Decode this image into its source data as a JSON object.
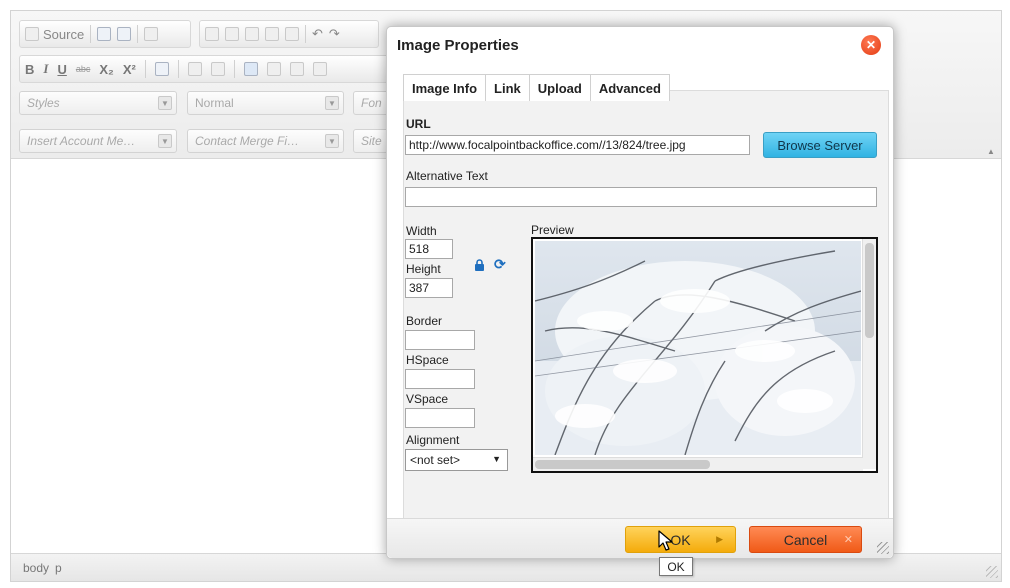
{
  "editor": {
    "toolbar": {
      "source_label": "Source",
      "bold_label": "B",
      "italic_label": "I",
      "underline_label": "U",
      "strike_label": "abc",
      "subscript_label": "X₂",
      "superscript_label": "X²",
      "styles_placeholder": "Styles",
      "format_value": "Normal",
      "font_placeholder": "Fon",
      "account_merge_placeholder": "Insert Account Me…",
      "contact_merge_placeholder": "Contact Merge Fi…",
      "site_placeholder": "Site"
    },
    "status_path": [
      "body",
      "p"
    ]
  },
  "dialog": {
    "title": "Image Properties",
    "close_symbol": "✕",
    "tabs": [
      {
        "label": "Image Info",
        "active": true
      },
      {
        "label": "Link",
        "active": false
      },
      {
        "label": "Upload",
        "active": false
      },
      {
        "label": "Advanced",
        "active": false
      }
    ],
    "url": {
      "label": "URL",
      "value": "http://www.focalpointbackoffice.com//13/824/tree.jpg"
    },
    "browse_server_label": "Browse Server",
    "alt_text": {
      "label": "Alternative Text",
      "value": ""
    },
    "width": {
      "label": "Width",
      "value": "518"
    },
    "height": {
      "label": "Height",
      "value": "387"
    },
    "border": {
      "label": "Border",
      "value": ""
    },
    "hspace": {
      "label": "HSpace",
      "value": ""
    },
    "vspace": {
      "label": "VSpace",
      "value": ""
    },
    "alignment": {
      "label": "Alignment",
      "value": "<not set>"
    },
    "preview_label": "Preview",
    "buttons": {
      "ok": "OK",
      "cancel": "Cancel"
    },
    "tooltip": "OK"
  }
}
